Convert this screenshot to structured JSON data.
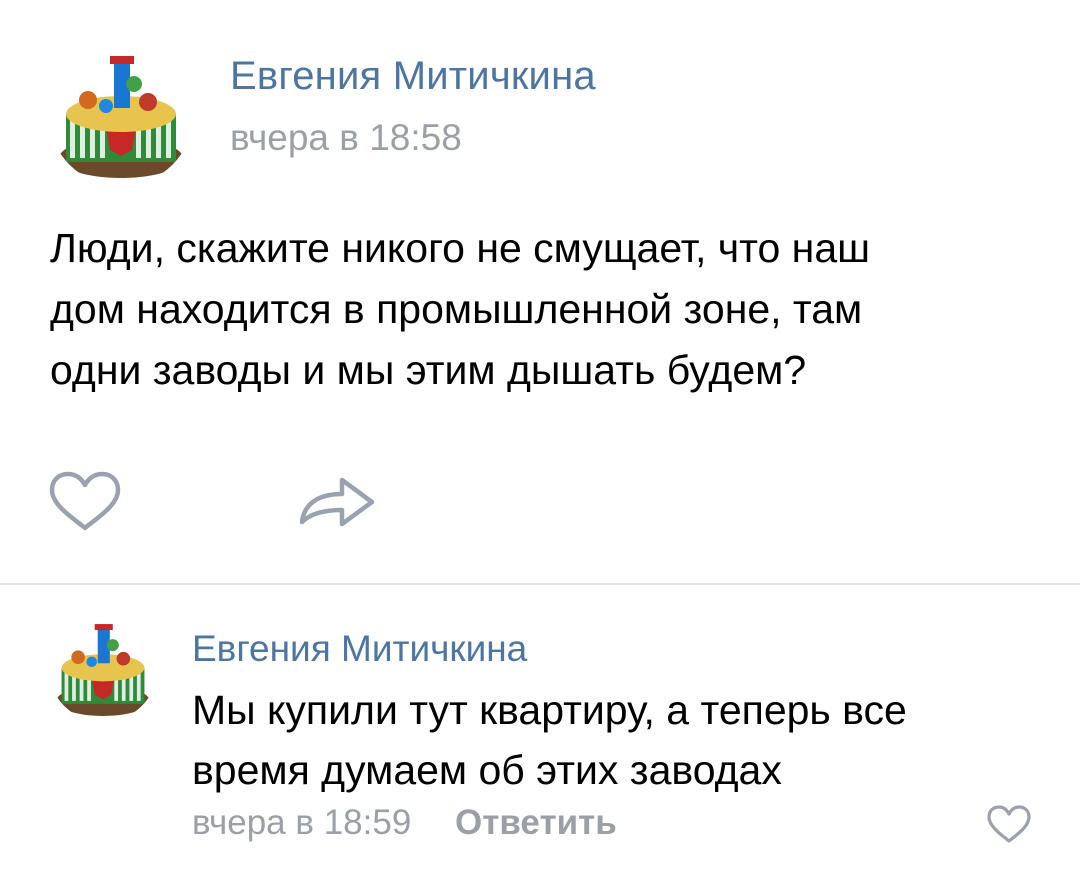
{
  "post": {
    "author": "Евгения Митичкина",
    "time": "вчера в 18:58",
    "text_lines": [
      "Люди, скажите никого не смущает, что наш",
      "дом находится в промышленной зоне, там",
      "одни заводы и мы этим дышать будем?"
    ],
    "actions": {
      "like_icon": "heart-outline-icon",
      "share_icon": "share-arrow-icon"
    }
  },
  "comment": {
    "author": "Евгения Митичкина",
    "text_lines": [
      "Мы купили тут квартиру, а теперь все",
      "время думаем об этих заводах"
    ],
    "time": "вчера в 18:59",
    "reply_label": "Ответить",
    "like_icon": "heart-outline-icon"
  },
  "colors": {
    "author_link": "#4d75a4",
    "meta_gray": "#9aa0a6",
    "icon_gray": "#99a2ad",
    "divider": "#e3e4e8"
  }
}
